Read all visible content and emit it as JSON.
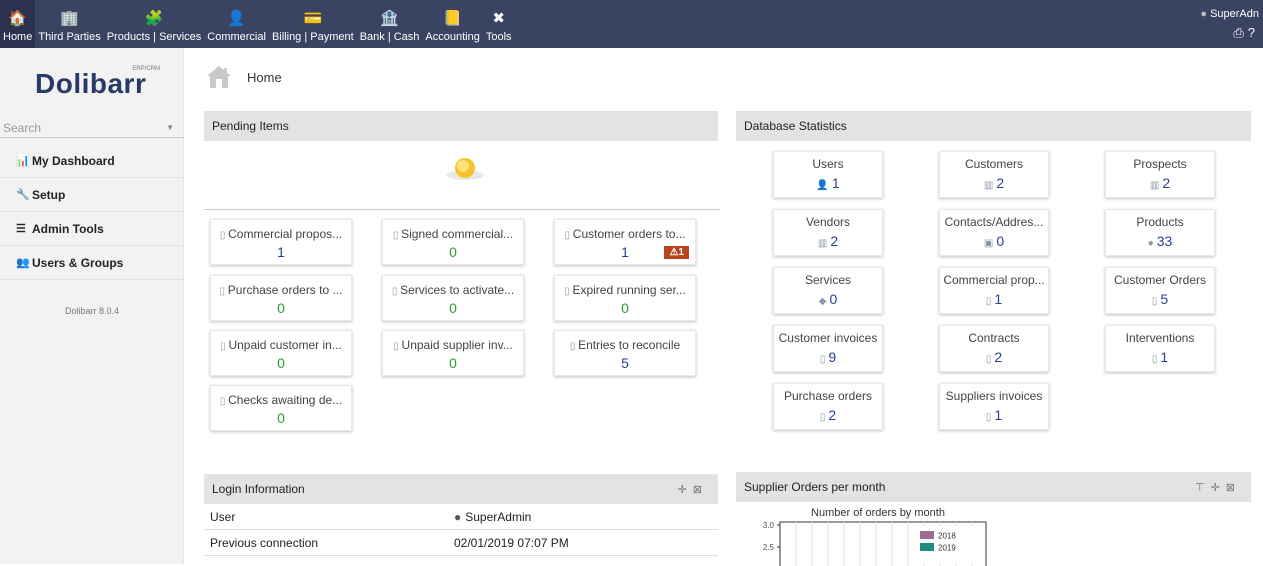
{
  "topnav": [
    {
      "label": "Home",
      "icon": "home-icon",
      "glyph": "🏠"
    },
    {
      "label": "Third Parties",
      "icon": "third-parties-icon",
      "glyph": "🏢"
    },
    {
      "label": "Products | Services",
      "icon": "products-icon",
      "glyph": "🧩"
    },
    {
      "label": "Commercial",
      "icon": "commercial-icon",
      "glyph": "👤"
    },
    {
      "label": "Billing | Payment",
      "icon": "billing-icon",
      "glyph": "💳"
    },
    {
      "label": "Bank | Cash",
      "icon": "bank-icon",
      "glyph": "🏦"
    },
    {
      "label": "Accounting",
      "icon": "accounting-icon",
      "glyph": "📒"
    },
    {
      "label": "Tools",
      "icon": "tools-icon",
      "glyph": "✖"
    }
  ],
  "user": {
    "name": "SuperAdn"
  },
  "logo": {
    "text": "Dolibarr",
    "sub": "ERP/CRM"
  },
  "search": {
    "placeholder": "Search"
  },
  "sidebar": {
    "items": [
      {
        "label": "My Dashboard",
        "icon": "dashboard-icon",
        "glyph": "📊"
      },
      {
        "label": "Setup",
        "icon": "wrench-icon",
        "glyph": "🔧"
      },
      {
        "label": "Admin Tools",
        "icon": "admin-tools-icon",
        "glyph": "☰"
      },
      {
        "label": "Users & Groups",
        "icon": "users-icon",
        "glyph": "👥"
      }
    ],
    "version": "Dolibarr 8.0.4"
  },
  "breadcrumb": {
    "title": "Home"
  },
  "pending": {
    "title": "Pending Items",
    "cards": [
      {
        "label": "Commercial propos...",
        "value": "1",
        "color": "blue"
      },
      {
        "label": "Signed commercial...",
        "value": "0",
        "color": "green"
      },
      {
        "label": "Customer orders to...",
        "value": "1",
        "color": "blue",
        "warning": "⚠1"
      },
      {
        "label": "Purchase orders to ...",
        "value": "0",
        "color": "green"
      },
      {
        "label": "Services to activate...",
        "value": "0",
        "color": "green"
      },
      {
        "label": "Expired running ser...",
        "value": "0",
        "color": "green"
      },
      {
        "label": "Unpaid customer in...",
        "value": "0",
        "color": "green"
      },
      {
        "label": "Unpaid supplier inv...",
        "value": "0",
        "color": "green"
      },
      {
        "label": "Entries to reconcile",
        "value": "5",
        "color": "blue"
      },
      {
        "label": "Checks awaiting de...",
        "value": "0",
        "color": "green"
      }
    ]
  },
  "stats": {
    "title": "Database Statistics",
    "cards": [
      {
        "label": "Users",
        "value": "1",
        "glyph": "👤"
      },
      {
        "label": "Customers",
        "value": "2",
        "glyph": "▥"
      },
      {
        "label": "Prospects",
        "value": "2",
        "glyph": "▥"
      },
      {
        "label": "Vendors",
        "value": "2",
        "glyph": "▥"
      },
      {
        "label": "Contacts/Addres...",
        "value": "0",
        "glyph": "▣"
      },
      {
        "label": "Products",
        "value": "33",
        "glyph": "●"
      },
      {
        "label": "Services",
        "value": "0",
        "glyph": "◆"
      },
      {
        "label": "Commercial prop...",
        "value": "1",
        "glyph": "▯"
      },
      {
        "label": "Customer Orders",
        "value": "5",
        "glyph": "▯"
      },
      {
        "label": "Customer invoices",
        "value": "9",
        "glyph": "▯"
      },
      {
        "label": "Contracts",
        "value": "2",
        "glyph": "▯"
      },
      {
        "label": "Interventions",
        "value": "1",
        "glyph": "▯"
      },
      {
        "label": "Purchase orders",
        "value": "2",
        "glyph": "▯"
      },
      {
        "label": "Suppliers invoices",
        "value": "1",
        "glyph": "▯"
      }
    ]
  },
  "login": {
    "title": "Login Information",
    "rows": [
      {
        "label": "User",
        "value": "SuperAdmin"
      },
      {
        "label": "Previous connection",
        "value": "02/01/2019 07:07 PM"
      }
    ]
  },
  "orders": {
    "title": "Supplier Orders per month",
    "chart_title": "Number of orders by month"
  },
  "chart_data": {
    "type": "bar",
    "title": "Number of orders by month",
    "series": [
      {
        "name": "2018",
        "color": "#9b6b93"
      },
      {
        "name": "2019",
        "color": "#1e8c7e"
      }
    ],
    "y_ticks": [
      "3.0",
      "2.5"
    ],
    "legend": "top-right"
  }
}
